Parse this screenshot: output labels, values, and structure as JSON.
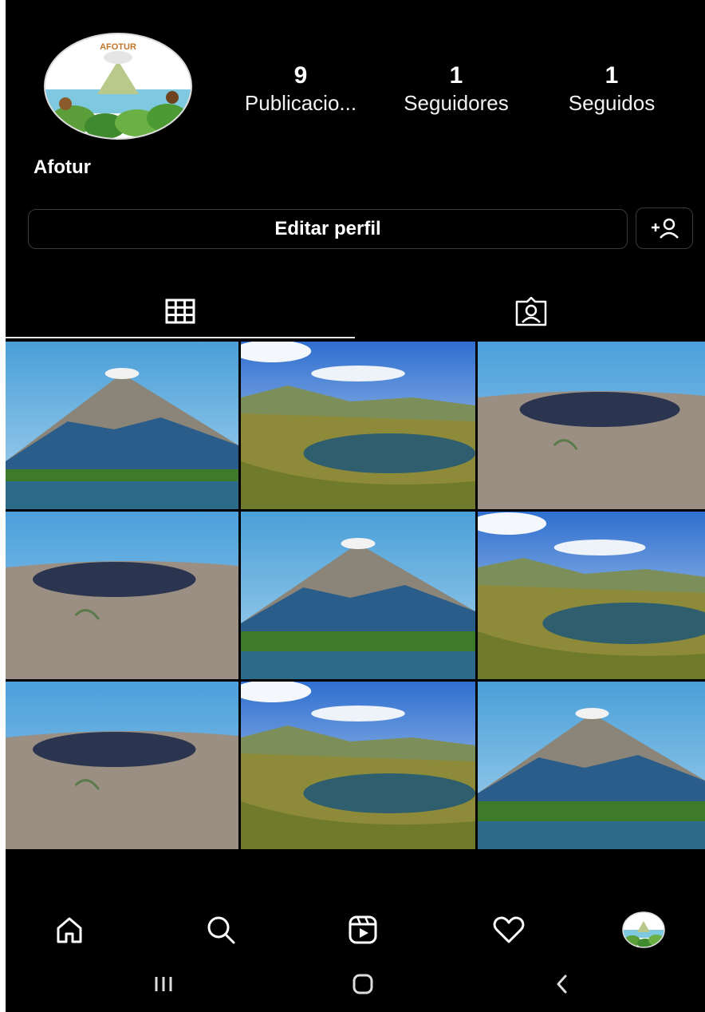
{
  "profile": {
    "avatar_text": "AFOTUR",
    "username": "Afotur",
    "stats": [
      {
        "value": "9",
        "label": "Publicacio..."
      },
      {
        "value": "1",
        "label": "Seguidores"
      },
      {
        "value": "1",
        "label": "Seguidos"
      }
    ],
    "edit_button": "Editar perfil",
    "add_person_icon": "add-person-icon"
  },
  "tabs": [
    {
      "icon": "grid-icon",
      "active": true
    },
    {
      "icon": "tagged-icon",
      "active": false
    }
  ],
  "posts": [
    {
      "subject": "volcano"
    },
    {
      "subject": "lagoon"
    },
    {
      "subject": "crater"
    },
    {
      "subject": "crater"
    },
    {
      "subject": "volcano"
    },
    {
      "subject": "lagoon"
    },
    {
      "subject": "crater"
    },
    {
      "subject": "lagoon"
    },
    {
      "subject": "volcano"
    }
  ],
  "bottom_nav": [
    "home-icon",
    "search-icon",
    "reels-icon",
    "heart-icon",
    "profile-avatar"
  ],
  "system_nav": [
    "recent-apps-icon",
    "home-button-icon",
    "back-icon"
  ],
  "colors": {
    "background": "#000000",
    "text": "#ffffff",
    "border": "#3a3a3a"
  }
}
